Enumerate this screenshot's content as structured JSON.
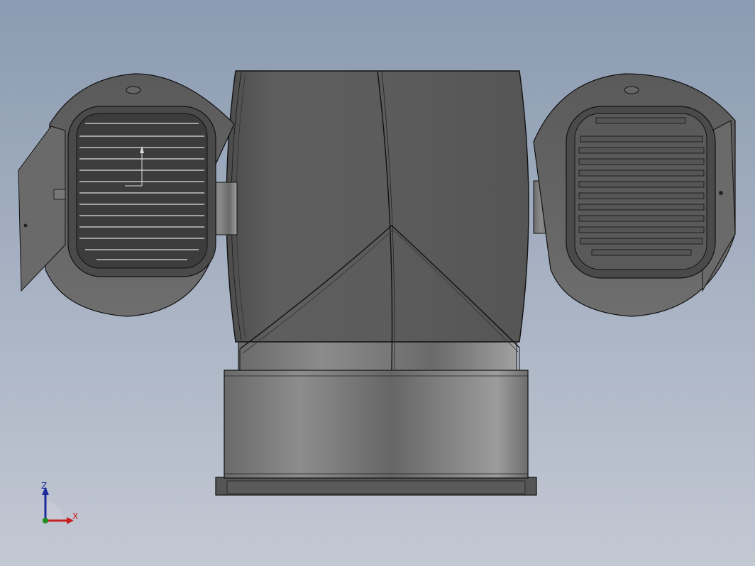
{
  "colors": {
    "background_top": "#8b9bb1",
    "background_bottom": "#c3c8d3",
    "body": "#5f5f5f",
    "edge": "#111111",
    "axis_x": "#c81e1e",
    "axis_y": "#1e8c1e",
    "axis_z": "#1e2a9a"
  },
  "triad": {
    "z_label": "Z",
    "x_label": "X",
    "x_color": "#c81e1e",
    "z_color": "#1e2a9a"
  }
}
